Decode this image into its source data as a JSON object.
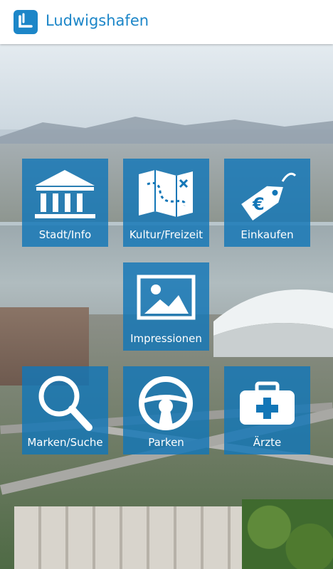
{
  "app": {
    "title": "Ludwigshafen",
    "logo_letter": "L",
    "logo_icon": "ludwigshafen-logo-icon",
    "accent_color": "#1c86c8"
  },
  "tiles": [
    {
      "label": "Stadt/Info",
      "icon": "museum-icon"
    },
    {
      "label": "Kultur/Freizeit",
      "icon": "map-icon"
    },
    {
      "label": "Einkaufen",
      "icon": "price-tag-icon"
    },
    {
      "label": "Impressionen",
      "icon": "image-icon"
    },
    {
      "label": "Marken/Suche",
      "icon": "search-icon"
    },
    {
      "label": "Parken",
      "icon": "steering-wheel-icon"
    },
    {
      "label": "Ärzte",
      "icon": "first-aid-kit-icon"
    }
  ],
  "tile_color": "#1276b7",
  "price_tag_symbol": "€"
}
